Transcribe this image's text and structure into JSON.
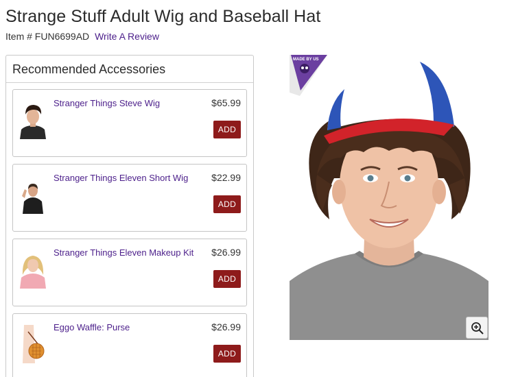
{
  "product": {
    "title": "Strange Stuff Adult Wig and Baseball Hat",
    "item_label": "Item # FUN6699AD",
    "review_link": "Write A Review"
  },
  "accessories": {
    "heading": "Recommended Accessories",
    "items": [
      {
        "name": "Stranger Things Steve Wig",
        "price": "$65.99",
        "button": "ADD",
        "icon": "steve-wig-thumbnail"
      },
      {
        "name": "Stranger Things Eleven Short Wig",
        "price": "$22.99",
        "button": "ADD",
        "icon": "eleven-wig-thumbnail"
      },
      {
        "name": "Stranger Things Eleven Makeup Kit",
        "price": "$26.99",
        "button": "ADD",
        "icon": "eleven-makeup-thumbnail"
      },
      {
        "name": "Eggo Waffle: Purse",
        "price": "$26.99",
        "button": "ADD",
        "icon": "waffle-purse-thumbnail"
      }
    ]
  },
  "hero": {
    "badge_text": "MADE BY US",
    "zoom_icon": "zoom-in-icon"
  },
  "colors": {
    "link": "#4b1e8a",
    "add_button": "#8e1b1b",
    "border": "#c9c9c9"
  }
}
